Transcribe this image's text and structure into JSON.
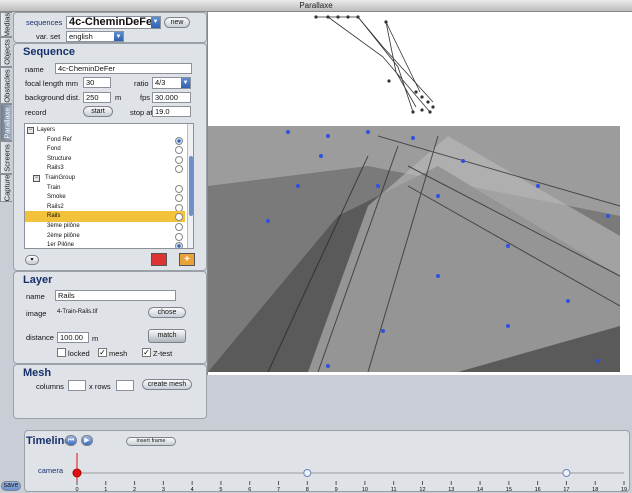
{
  "window": {
    "title": "Parallaxe"
  },
  "tabs": [
    "Medias",
    "Objects",
    "Obstacles",
    "Parallaxe",
    "Screens",
    "Capture"
  ],
  "top": {
    "sequences_label": "sequences",
    "sequence_value": "4c-CheminDeFer",
    "new_label": "new",
    "varset_label": "var. set",
    "varset_value": "english"
  },
  "sequence": {
    "title": "Sequence",
    "name_label": "name",
    "name_value": "4c-CheminDeFer",
    "focal_label": "focal length mm",
    "focal_value": "30",
    "ratio_label": "ratio",
    "ratio_value": "4/3",
    "bgdist_label": "background dist.",
    "bgdist_value": "250",
    "bgdist_unit": "m",
    "fps_label": "fps",
    "fps_value": "30.000",
    "record_label": "record",
    "start_label": "start",
    "stopat_label": "stop at",
    "stopat_value": "19.0"
  },
  "layers": {
    "items": [
      {
        "label": "Layers",
        "kind": "folder"
      },
      {
        "label": "Fond Ref",
        "kind": "item",
        "radio": "on"
      },
      {
        "label": "Fond",
        "kind": "item",
        "radio": "off"
      },
      {
        "label": "Structure",
        "kind": "item",
        "radio": "off"
      },
      {
        "label": "Rails3",
        "kind": "item",
        "radio": "off"
      },
      {
        "label": "TrainGroup",
        "kind": "folder"
      },
      {
        "label": "Train",
        "kind": "item",
        "radio": "off"
      },
      {
        "label": "Smoke",
        "kind": "item",
        "radio": "off"
      },
      {
        "label": "Rails2",
        "kind": "item",
        "radio": "off"
      },
      {
        "label": "Rails",
        "kind": "item",
        "radio": "off",
        "selected": true
      },
      {
        "label": "3ème pilône",
        "kind": "item",
        "radio": "off"
      },
      {
        "label": "2ème pilône",
        "kind": "item",
        "radio": "off"
      },
      {
        "label": "1er Pilône",
        "kind": "item",
        "radio": "on"
      }
    ]
  },
  "layer": {
    "title": "Layer",
    "name_label": "name",
    "name_value": "Rails",
    "image_label": "image",
    "image_value": "4-Train-Rails.tif",
    "chose_label": "chose",
    "distance_label": "distance",
    "distance_value": "100.00",
    "distance_unit": "m",
    "match_label": "match",
    "locked_label": "locked",
    "locked_checked": "",
    "mesh_label": "mesh",
    "mesh_checked": "✓",
    "ztest_label": "Z-test",
    "ztest_checked": "✓"
  },
  "mesh": {
    "title": "Mesh",
    "columns_label": "columns",
    "rows_label": "x rows",
    "create_label": "create mesh"
  },
  "timeline": {
    "title": "Timeline",
    "insert_label": "insert frame",
    "track_label": "camera",
    "ruler_marks": [
      "0",
      "1",
      "2",
      "3",
      "4",
      "5",
      "6",
      "7",
      "8",
      "9",
      "10",
      "11",
      "12",
      "13",
      "14",
      "15",
      "16",
      "17",
      "18",
      "19"
    ],
    "keyframes": [
      0,
      8,
      17
    ]
  },
  "save_label": "save"
}
